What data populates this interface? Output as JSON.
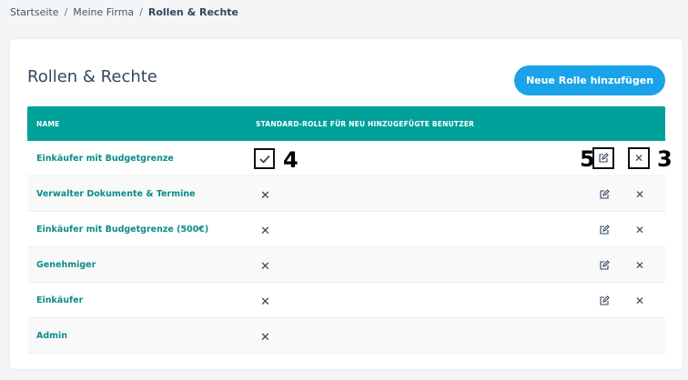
{
  "breadcrumb": {
    "home": "Startseite",
    "company": "Meine Firma",
    "current": "Rollen & Rechte",
    "sep": "/"
  },
  "page": {
    "title": "Rollen & Rechte",
    "add_button": "Neue Rolle hinzufügen"
  },
  "table": {
    "headers": {
      "name": "NAME",
      "default_role": "STANDARD-ROLLE FÜR NEU HINZUGEFÜGTE BENUTZER"
    },
    "rows": [
      {
        "name": "Einkäufer mit Budgetgrenze",
        "default": true
      },
      {
        "name": "Verwalter Dokumente & Termine",
        "default": false
      },
      {
        "name": "Einkäufer mit Budgetgrenze (500€)",
        "default": false
      },
      {
        "name": "Genehmiger",
        "default": false
      },
      {
        "name": "Einkäufer",
        "default": false
      },
      {
        "name": "Admin",
        "default": false
      }
    ]
  },
  "annotations": {
    "label_4": "4",
    "label_5": "5",
    "label_3": "3"
  },
  "icons": {
    "edit": "edit-icon",
    "delete": "close-icon",
    "check": "check-icon"
  },
  "colors": {
    "header_bg": "#00a19a",
    "button_bg": "#1aa3e8",
    "row_name": "#0b8c8a"
  }
}
